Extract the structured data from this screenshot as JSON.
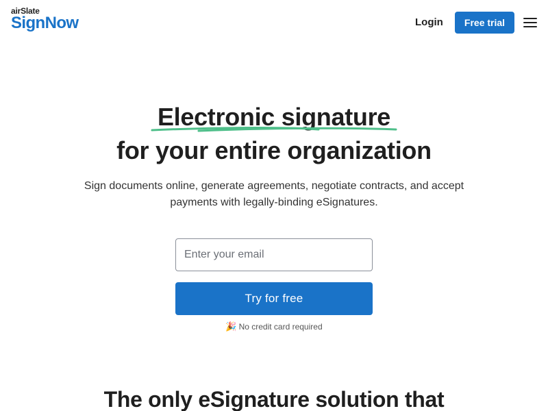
{
  "header": {
    "logo_top": "airSlate",
    "logo_main": "SignNow",
    "login_label": "Login",
    "trial_label": "Free trial",
    "menu_icon": "hamburger-menu-icon"
  },
  "hero": {
    "title_line1": "Electronic signature",
    "title_line2": "for your entire organization",
    "subtitle": "Sign documents online, generate agreements, negotiate contracts, and accept payments with legally-binding eSignatures.",
    "email_placeholder": "Enter your email",
    "email_value": "",
    "cta_label": "Try for free",
    "note_icon": "party-popper-icon",
    "note": "No credit card required"
  },
  "section": {
    "title": "The only eSignature solution that"
  },
  "colors": {
    "brand_blue": "#1a73c8",
    "underline_green": "#4fbf8a",
    "text_dark": "#1f1f1f"
  }
}
